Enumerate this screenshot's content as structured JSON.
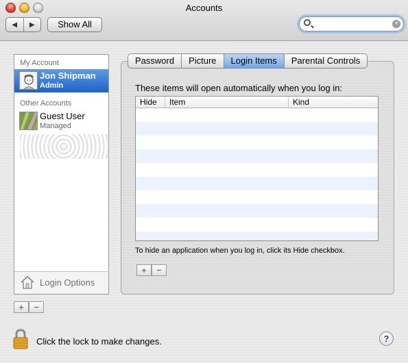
{
  "window": {
    "title": "Accounts"
  },
  "toolbar": {
    "back_glyph": "◀",
    "forward_glyph": "▶",
    "show_all_label": "Show All",
    "search": {
      "value": "",
      "placeholder": ""
    }
  },
  "sidebar": {
    "my_account_header": "My Account",
    "other_accounts_header": "Other Accounts",
    "accounts": [
      {
        "name": "Jon Shipman",
        "role": "Admin",
        "icon": "user-photo-icon",
        "selected": true
      },
      {
        "name": "Guest User",
        "role": "Managed",
        "icon": "guest-photo-icon",
        "selected": false
      }
    ],
    "login_options_label": "Login Options",
    "add_label": "+",
    "remove_label": "−"
  },
  "tabs": [
    {
      "label": "Password",
      "active": false
    },
    {
      "label": "Picture",
      "active": false
    },
    {
      "label": "Login Items",
      "active": true
    },
    {
      "label": "Parental Controls",
      "active": false
    }
  ],
  "login_items": {
    "intro": "These items will open automatically when you log in:",
    "columns": [
      "Hide",
      "Item",
      "Kind"
    ],
    "rows": [],
    "hint": "To hide an application when you log in, click its Hide checkbox.",
    "add_label": "+",
    "remove_label": "−"
  },
  "footer": {
    "lock_text": "Click the lock to make changes.",
    "help_label": "?"
  },
  "colors": {
    "selection": "#2f72d6",
    "active_tab": "#8dbcef",
    "row_stripe": "#edf3fe"
  }
}
